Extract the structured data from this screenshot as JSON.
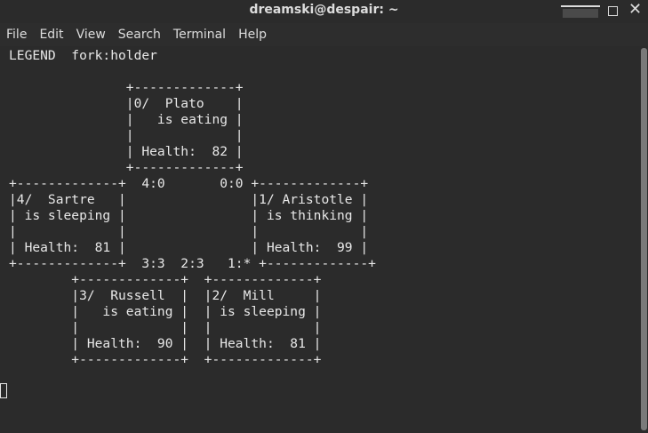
{
  "window": {
    "title": "dreamski@despair: ~",
    "close_glyph": "✕"
  },
  "menu": {
    "items": [
      "File",
      "Edit",
      "View",
      "Search",
      "Terminal",
      "Help"
    ]
  },
  "terminal": {
    "legend": "LEGEND  fork:holder",
    "lines": [
      "LEGEND  fork:holder",
      "",
      "               +-------------+",
      "               |0/  Plato    |",
      "               |   is eating |",
      "               |             |",
      "               | Health:  82 |",
      "               +-------------+",
      "+-------------+  4:0       0:0 +-------------+",
      "|4/  Sartre   |                |1/ Aristotle |",
      "| is sleeping |                | is thinking |",
      "|             |                |             |",
      "| Health:  81 |                | Health:  99 |",
      "+-------------+  3:3  2:3   1:* +-------------+",
      "        +-------------+  +-------------+",
      "        |3/  Russell  |  |2/  Mill     |",
      "        |   is eating |  | is sleeping |",
      "        |             |  |             |",
      "        | Health:  90 |  | Health:  81 |",
      "        +-------------+  +-------------+"
    ],
    "philosophers": [
      {
        "id": "0",
        "name": "Plato",
        "state": "is eating",
        "health": 82
      },
      {
        "id": "1",
        "name": "Aristotle",
        "state": "is thinking",
        "health": 99
      },
      {
        "id": "2",
        "name": "Mill",
        "state": "is sleeping",
        "health": 81
      },
      {
        "id": "3",
        "name": "Russell",
        "state": "is eating",
        "health": 90
      },
      {
        "id": "4",
        "name": "Sartre",
        "state": "is sleeping",
        "health": 81
      }
    ],
    "forks": [
      "4:0",
      "0:0",
      "3:3",
      "2:3",
      "1:*"
    ]
  },
  "colors": {
    "background": "#2b2b2b",
    "text": "#e8e8e8",
    "chrome_text": "#dcdcdc"
  }
}
